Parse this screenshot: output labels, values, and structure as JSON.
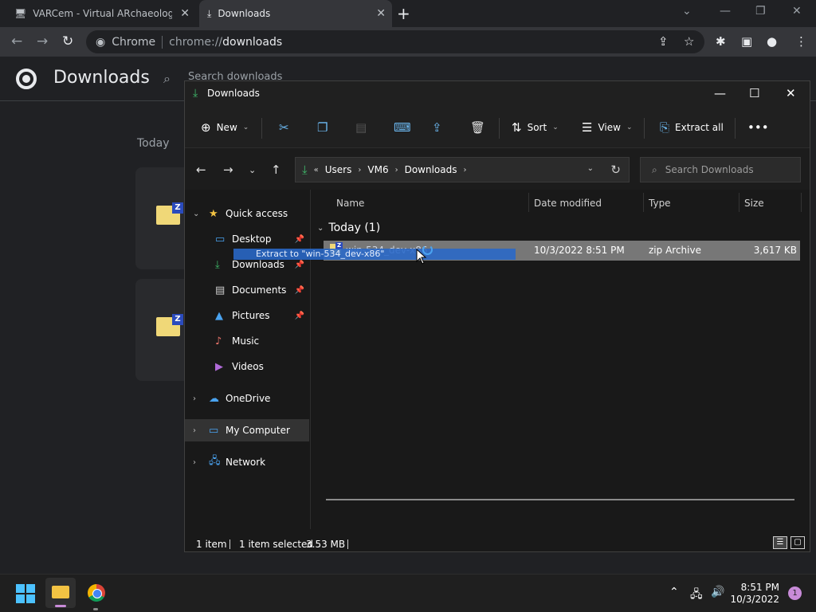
{
  "chrome": {
    "tabs": [
      {
        "title": "VARCem - Virtual ARchaeological Computer EMulator"
      },
      {
        "title": "Downloads"
      }
    ],
    "omnibox": {
      "chip": "Chrome",
      "url_prefix": "chrome://",
      "url_host": "downloads"
    }
  },
  "downloads_page": {
    "title": "Downloads",
    "search_placeholder": "Search downloads",
    "group_label": "Today"
  },
  "explorer": {
    "window_title": "Downloads",
    "commands": {
      "new": "New",
      "sort": "Sort",
      "view": "View",
      "extract_all": "Extract all"
    },
    "address": {
      "overflow": "«",
      "crumbs": [
        "Users",
        "VM6",
        "Downloads"
      ]
    },
    "search_placeholder": "Search Downloads",
    "nav": {
      "quick_access": "Quick access",
      "items": [
        "Desktop",
        "Downloads",
        "Documents",
        "Pictures",
        "Music",
        "Videos"
      ],
      "onedrive": "OneDrive",
      "my_computer": "My Computer",
      "network": "Network"
    },
    "columns": {
      "name": "Name",
      "date_modified": "Date modified",
      "type": "Type",
      "size": "Size"
    },
    "group": "Today (1)",
    "file": {
      "name": "win-534_dev-x86",
      "date": "10/3/2022 8:51 PM",
      "type": "zip Archive",
      "size": "3,617 KB"
    },
    "drag_tooltip": "Extract to \"win-534_dev-x86\"",
    "status": {
      "count": "1 item",
      "selected": "1 item selected",
      "size": "3.53 MB"
    }
  },
  "taskbar": {
    "time": "8:51 PM",
    "date": "10/3/2022",
    "notifications": "1"
  }
}
